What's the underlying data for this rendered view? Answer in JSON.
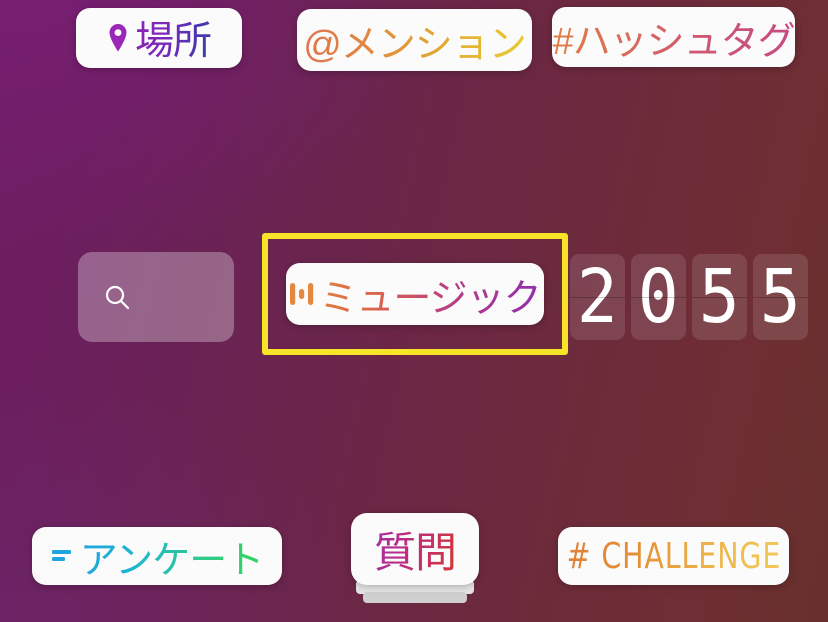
{
  "background": {
    "gradient_from": "#6e1d63",
    "gradient_to": "#67302c"
  },
  "top_row": {
    "location": {
      "label": "場所",
      "icon": "location-pin-icon",
      "icon_color": "#9b27b8",
      "gradient_from": "#8b23b4",
      "gradient_to": "#2f3fa8"
    },
    "mention": {
      "label": "@メンション",
      "gradient_from": "#df7450",
      "gradient_to": "#e8cb33"
    },
    "hashtag": {
      "label": "#ハッシュタグ",
      "gradient_from": "#e08046",
      "gradient_to": "#c54a84"
    }
  },
  "middle_row": {
    "search": {
      "icon": "search-icon",
      "value": "",
      "placeholder": ""
    },
    "music": {
      "label": "ミュージック",
      "icon": "music-equalizer-icon",
      "icon_color": "#e4883f",
      "gradient_from": "#e0803f",
      "gradient_to": "#8f2fae",
      "highlighted": true,
      "highlight_color": "#f7e327"
    },
    "clock": {
      "digits": [
        "2",
        "0",
        "5",
        "5"
      ],
      "value": "2055"
    }
  },
  "bottom_row": {
    "poll": {
      "label": "アンケート",
      "icon": "poll-bars-icon",
      "icon_color": "#1fa5e0",
      "gradient_from": "#1fa5e0",
      "gradient_to": "#35d45e"
    },
    "question": {
      "label": "質問",
      "gradient_from": "#a330a8",
      "gradient_to": "#cf3b33"
    },
    "challenge": {
      "label": "# CHALLENGE",
      "gradient_from": "#e08038",
      "gradient_to": "#f2c95a"
    }
  }
}
